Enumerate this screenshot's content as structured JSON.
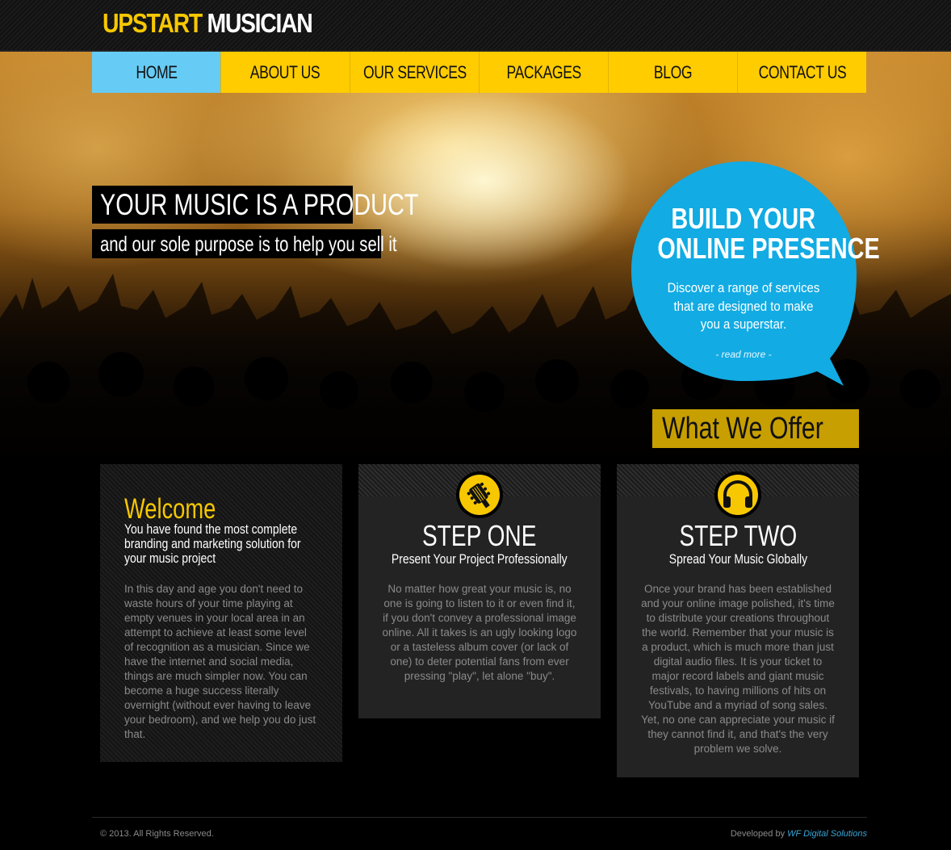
{
  "header": {
    "logo_part1": "UPSTART",
    "logo_part2": "MUSICIAN"
  },
  "nav": {
    "items": [
      {
        "label": "HOME",
        "active": true
      },
      {
        "label": "ABOUT US"
      },
      {
        "label": "OUR SERVICES"
      },
      {
        "label": "PACKAGES"
      },
      {
        "label": "BLOG"
      },
      {
        "label": "CONTACT US"
      }
    ]
  },
  "hero": {
    "headline": "YOUR MUSIC IS A PRODUCT",
    "subline": "and our sole purpose is to help you sell it"
  },
  "bubble": {
    "title_line1": "BUILD YOUR",
    "title_line2": "ONLINE PRESENCE",
    "text": "Discover a range of services that are designed to make you a superstar.",
    "read_more": "- read more -"
  },
  "offer": {
    "label": "What We Offer"
  },
  "welcome": {
    "title": "Welcome",
    "subtitle": "You have found the most complete branding and marketing solution for your music project",
    "body": "In this day and age you don't need to waste hours of your time playing at empty venues in your local area in an attempt to achieve at least some level of recognition as a musician. Since we have the internet and social media, things are much simpler now. You can become a huge success literally overnight (without ever having to leave your bedroom), and we help you do just that."
  },
  "steps": [
    {
      "icon": "guitar-icon",
      "title": "STEP ONE",
      "subtitle": "Present Your Project Professionally",
      "body": "No matter how great your music is, no one is going to listen to it or even find it, if you don't convey a professional image online. All it takes is an ugly looking logo or a tasteless album cover (or lack of one) to deter potential fans from ever pressing \"play\", let alone \"buy\"."
    },
    {
      "icon": "headphones-icon",
      "title": "STEP TWO",
      "subtitle": "Spread Your Music Globally",
      "body": "Once your brand has been established and your online image polished, it's time to distribute your creations throughout the world. Remember that your music is a product, which is much more than just digital audio files. It is your ticket to major record labels and giant music festivals, to having millions of hits on YouTube and a myriad of song sales. Yet, no one can appreciate your music if they cannot find it, and that's the very problem we solve."
    }
  ],
  "footer": {
    "copyright": "© 2013. All Rights Reserved.",
    "developed_by": "Developed by",
    "developer": "WF Digital Solutions"
  },
  "colors": {
    "accent_yellow": "#ffcc00",
    "active_blue": "#66ccf5",
    "bubble_blue": "#12abe3"
  }
}
